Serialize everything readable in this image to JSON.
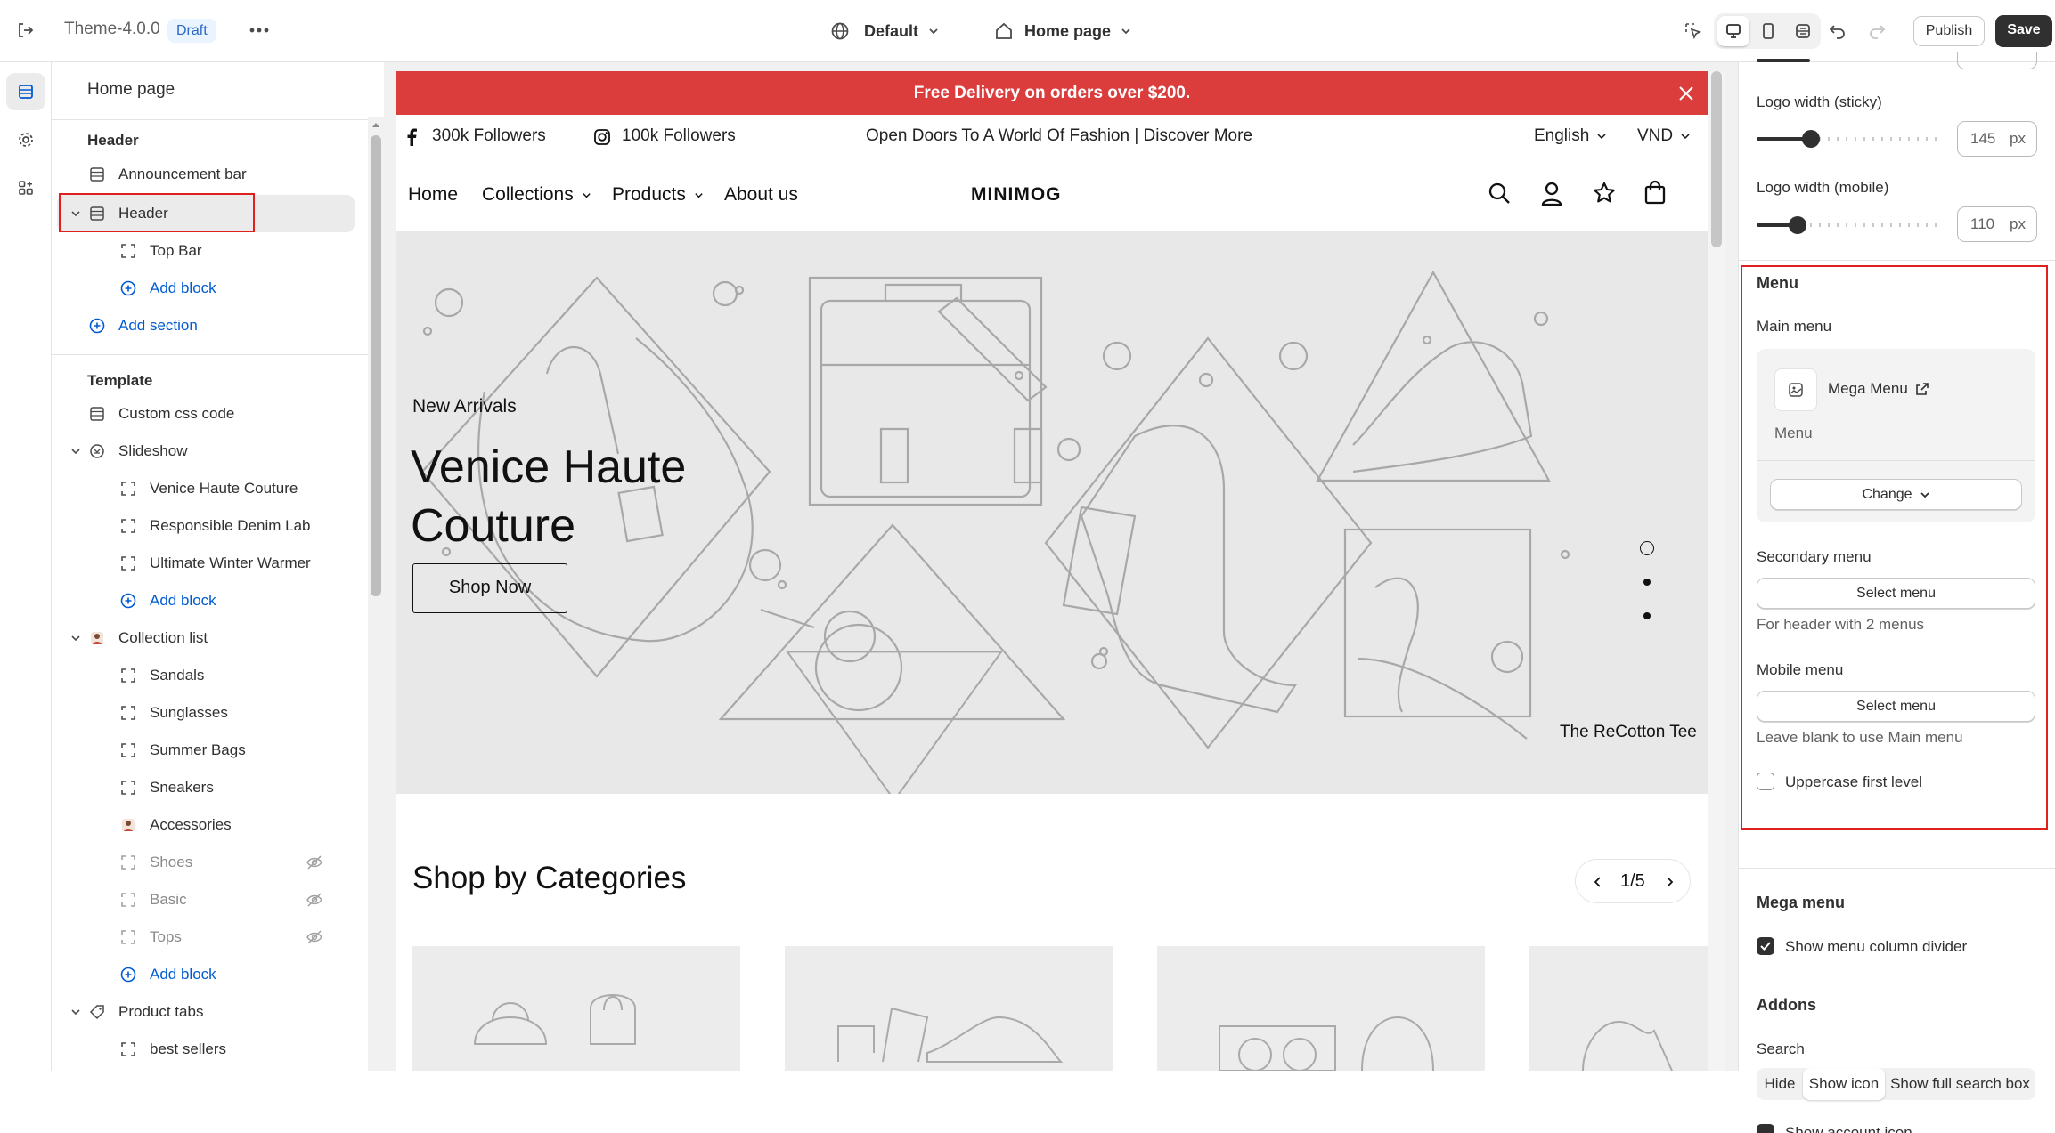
{
  "topbar": {
    "theme_name": "Theme-4.0.0",
    "draft_badge": "Draft",
    "template_selector": "Default",
    "page_selector": "Home page",
    "publish_label": "Publish",
    "save_label": "Save"
  },
  "sidebar": {
    "title": "Home page",
    "header_group": "Header",
    "header_items": [
      {
        "label": "Announcement bar"
      },
      {
        "label": "Header"
      },
      {
        "label": "Top Bar"
      },
      {
        "label": "Add block"
      },
      {
        "label": "Add section"
      }
    ],
    "template_group": "Template",
    "template_items": [
      {
        "label": "Custom css code"
      },
      {
        "label": "Slideshow"
      },
      {
        "label": "Venice Haute Couture"
      },
      {
        "label": "Responsible Denim Lab"
      },
      {
        "label": "Ultimate Winter Warmer"
      },
      {
        "label": "Add block"
      },
      {
        "label": "Collection list"
      },
      {
        "label": "Sandals"
      },
      {
        "label": "Sunglasses"
      },
      {
        "label": "Summer Bags"
      },
      {
        "label": "Sneakers"
      },
      {
        "label": "Accessories"
      },
      {
        "label": "Shoes"
      },
      {
        "label": "Basic"
      },
      {
        "label": "Tops"
      },
      {
        "label": "Add block"
      },
      {
        "label": "Product tabs"
      },
      {
        "label": "best sellers"
      }
    ]
  },
  "preview": {
    "announcement": "Free Delivery on orders over $200.",
    "facebook_followers": "300k Followers",
    "instagram_followers": "100k Followers",
    "tagline": "Open Doors To A World Of Fashion | Discover More",
    "language": "English",
    "currency": "VND",
    "nav": [
      "Home",
      "Collections",
      "Products",
      "About us"
    ],
    "logo": "MINIMOG",
    "hero": {
      "kicker": "New Arrivals",
      "title_line1": "Venice Haute",
      "title_line2": "Couture",
      "cta": "Shop Now",
      "caption": "The ReCotton Tee"
    },
    "categories_title": "Shop by Categories",
    "pager": "1/5"
  },
  "panel": {
    "logo_width_sticky_label": "Logo width (sticky)",
    "logo_width_sticky_value": "145",
    "logo_width_mobile_label": "Logo width (mobile)",
    "logo_width_mobile_value": "110",
    "unit": "px",
    "menu_heading": "Menu",
    "main_menu_label": "Main menu",
    "main_menu_name": "Mega Menu",
    "main_menu_sub": "Menu",
    "change_label": "Change",
    "secondary_menu_label": "Secondary menu",
    "select_menu_label": "Select menu",
    "secondary_help": "For header with 2 menus",
    "mobile_menu_label": "Mobile menu",
    "mobile_help": "Leave blank to use Main menu",
    "uppercase_label": "Uppercase first level",
    "mega_menu_heading": "Mega menu",
    "show_divider_label": "Show menu column divider",
    "addons_heading": "Addons",
    "search_label": "Search",
    "search_options": [
      "Hide",
      "Show icon",
      "Show full search box"
    ],
    "account_label": "Show account icon",
    "highlight_color": "#e0201c"
  }
}
